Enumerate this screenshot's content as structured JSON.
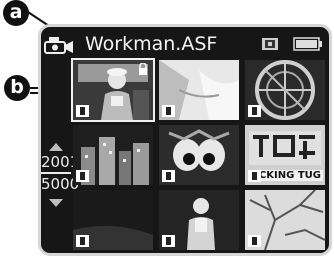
{
  "callouts": {
    "a": "a",
    "b": "b"
  },
  "header": {
    "filename": "Workman.ASF",
    "mode_icon": "movie-camera-icon",
    "memory_icon": "memory-card-icon",
    "battery_icon": "battery-icon",
    "battery_level": 1.0
  },
  "thumbnails": [
    {
      "scene": "workman",
      "selected": true,
      "locked": true
    },
    {
      "scene": "bright-white",
      "selected": false,
      "locked": false
    },
    {
      "scene": "fan-wheel",
      "selected": false,
      "locked": false
    },
    {
      "scene": "night-city",
      "selected": false,
      "locked": false
    },
    {
      "scene": "cartoon-eyes",
      "selected": false,
      "locked": false
    },
    {
      "scene": "chinese-sign",
      "selected": false,
      "locked": false,
      "caption": "CKING TUG"
    },
    {
      "scene": "dark",
      "selected": false,
      "locked": false
    },
    {
      "scene": "person",
      "selected": false,
      "locked": false
    },
    {
      "scene": "tree-branches",
      "selected": false,
      "locked": false
    }
  ],
  "counter": {
    "current": "2001",
    "total": "5000"
  },
  "colors": {
    "screen": "#161616",
    "text": "#f4f4f4",
    "selection": "#f0f0f0"
  }
}
